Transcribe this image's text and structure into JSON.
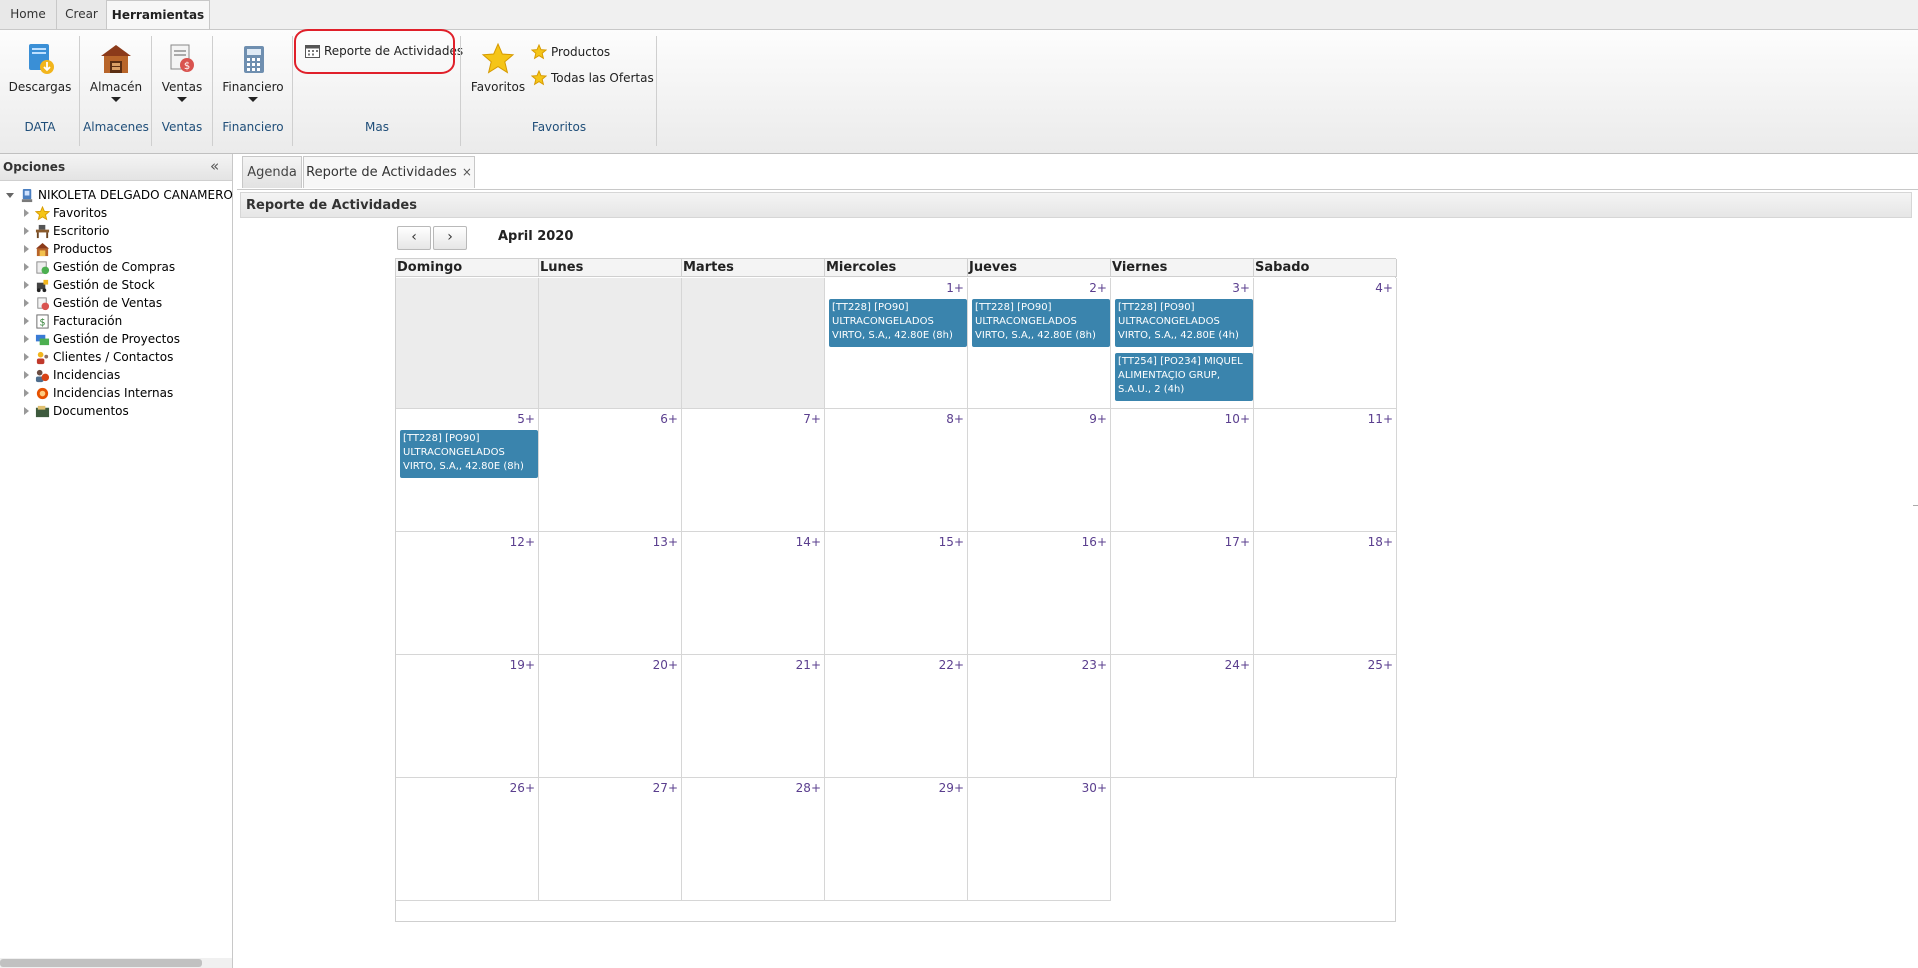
{
  "ribbon": {
    "tabs": [
      {
        "label": "Home"
      },
      {
        "label": "Crear"
      },
      {
        "label": "Herramientas"
      }
    ],
    "buttons": {
      "descargas": "Descargas",
      "almacen": "Almacén",
      "ventas": "Ventas",
      "financiero": "Financiero",
      "favoritos": "Favoritos",
      "reporte_actividades": "Reporte de Actividades",
      "productos": "Productos",
      "todas_ofertas": "Todas las Ofertas"
    },
    "groups": {
      "data": "DATA",
      "almacenes": "Almacenes",
      "ventas": "Ventas",
      "financiero": "Financiero",
      "mas": "Mas",
      "favoritos": "Favoritos"
    }
  },
  "sidebar": {
    "title": "Opciones",
    "root": "NIKOLETA DELGADO CANAMERO (D",
    "items": [
      {
        "label": "Favoritos",
        "icon": "star-icon"
      },
      {
        "label": "Escritorio",
        "icon": "desk-icon"
      },
      {
        "label": "Productos",
        "icon": "products-icon"
      },
      {
        "label": "Gestión de Compras",
        "icon": "purchases-icon"
      },
      {
        "label": "Gestión de Stock",
        "icon": "stock-icon"
      },
      {
        "label": "Gestión de Ventas",
        "icon": "sales-icon"
      },
      {
        "label": "Facturación",
        "icon": "invoice-icon"
      },
      {
        "label": "Gestión de Proyectos",
        "icon": "projects-icon"
      },
      {
        "label": "Clientes / Contactos",
        "icon": "contacts-icon"
      },
      {
        "label": "Incidencias",
        "icon": "incidents-icon"
      },
      {
        "label": "Incidencias Internas",
        "icon": "internal-incidents-icon"
      },
      {
        "label": "Documentos",
        "icon": "documents-icon"
      }
    ]
  },
  "main": {
    "tabs": [
      {
        "label": "Agenda"
      },
      {
        "label": "Reporte de Actividades"
      }
    ],
    "close_glyph": "×",
    "panel_title": "Reporte de Actividades",
    "nav": {
      "prev": "‹",
      "next": "›"
    },
    "month": "April 2020",
    "weekdays": [
      "Domingo",
      "Lunes",
      "Martes",
      "Miercoles",
      "Jueves",
      "Viernes",
      "Sabado"
    ],
    "weeks": [
      [
        {
          "day": ""
        },
        {
          "day": ""
        },
        {
          "day": ""
        },
        {
          "day": "1+",
          "events": [
            "[TT228] [PO90] ULTRACONGELADOS VIRTO, S.A,, 42.80E (8h)"
          ]
        },
        {
          "day": "2+",
          "events": [
            "[TT228] [PO90] ULTRACONGELADOS VIRTO, S.A,, 42.80E (8h)"
          ]
        },
        {
          "day": "3+",
          "events": [
            "[TT228] [PO90] ULTRACONGELADOS VIRTO, S.A,, 42.80E (4h)",
            "[TT254] [PO234] MIQUEL ALIMENTAÇIO GRUP, S.A.U., 2 (4h)"
          ]
        },
        {
          "day": "4+"
        }
      ],
      [
        {
          "day": "5+",
          "events": [
            "[TT228] [PO90] ULTRACONGELADOS VIRTO, S.A,, 42.80E (8h)"
          ]
        },
        {
          "day": "6+"
        },
        {
          "day": "7+"
        },
        {
          "day": "8+"
        },
        {
          "day": "9+"
        },
        {
          "day": "10+"
        },
        {
          "day": "11+"
        }
      ],
      [
        {
          "day": "12+"
        },
        {
          "day": "13+"
        },
        {
          "day": "14+"
        },
        {
          "day": "15+"
        },
        {
          "day": "16+"
        },
        {
          "day": "17+"
        },
        {
          "day": "18+"
        }
      ],
      [
        {
          "day": "19+"
        },
        {
          "day": "20+"
        },
        {
          "day": "21+"
        },
        {
          "day": "22+"
        },
        {
          "day": "23+"
        },
        {
          "day": "24+"
        },
        {
          "day": "25+"
        }
      ],
      [
        {
          "day": "26+"
        },
        {
          "day": "27+"
        },
        {
          "day": "28+"
        },
        {
          "day": "29+"
        },
        {
          "day": "30+"
        }
      ]
    ]
  },
  "colors": {
    "event_bg": "#3a84ad",
    "day_number": "#5a3e8e",
    "highlight": "#e0202a"
  }
}
